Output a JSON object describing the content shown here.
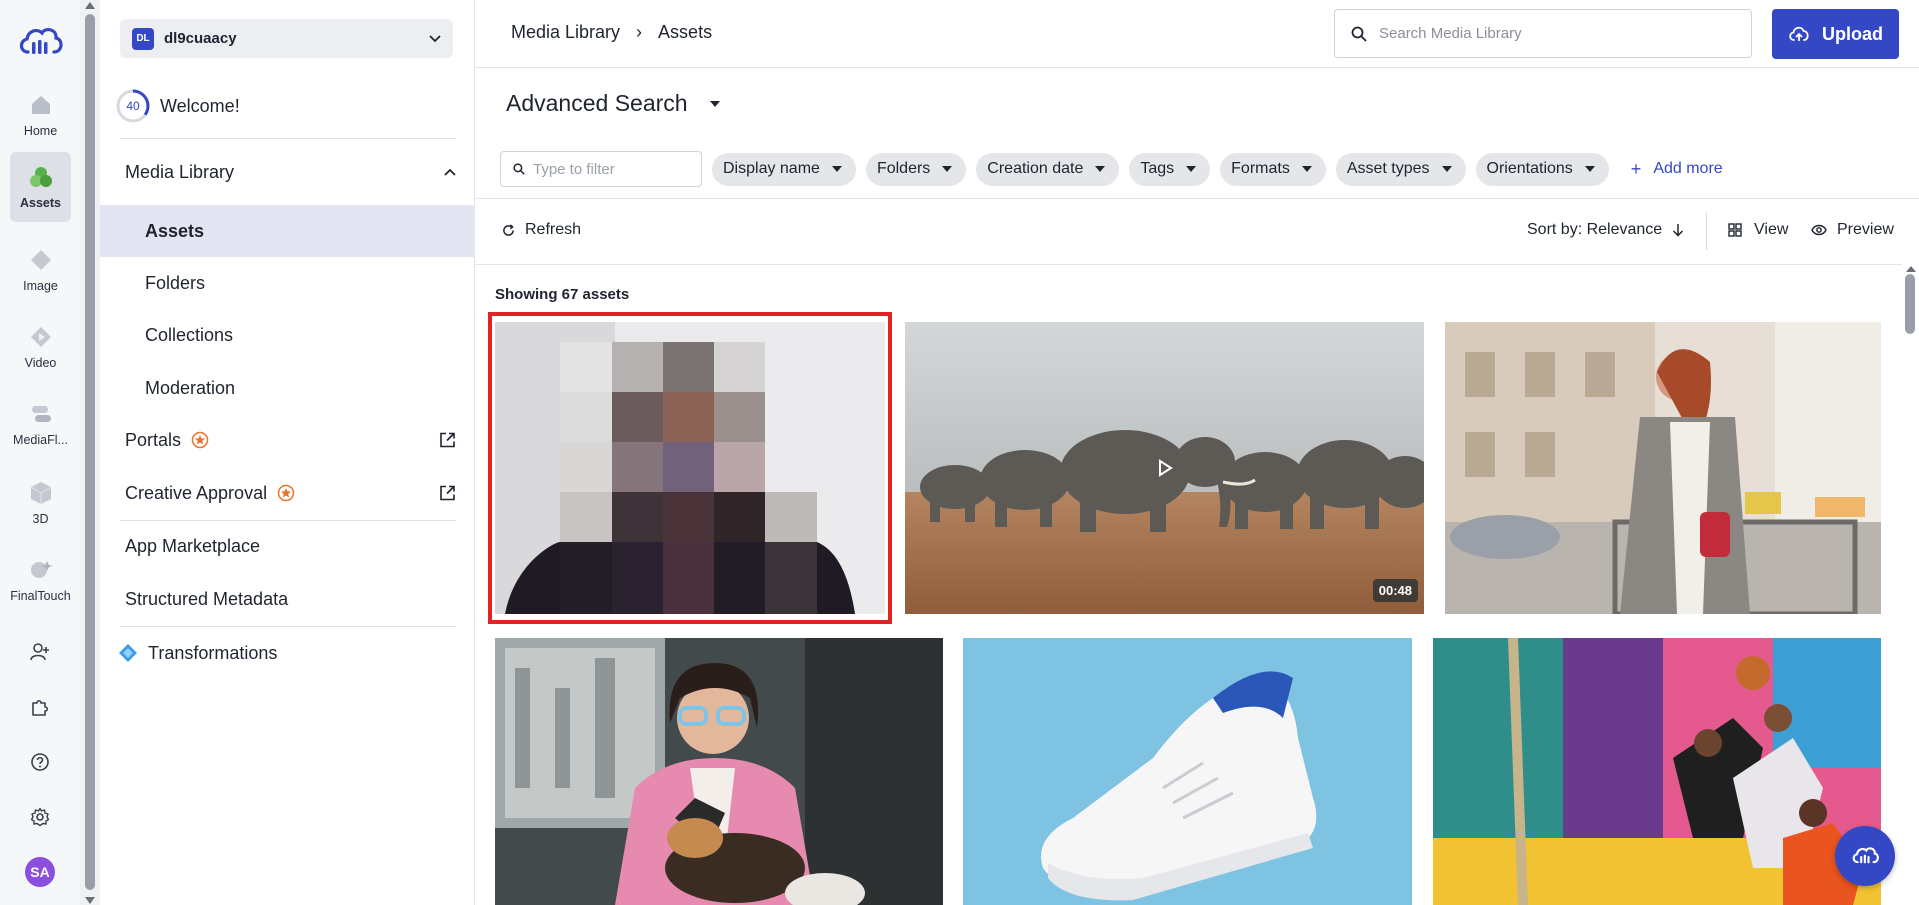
{
  "rail": {
    "items": [
      {
        "label": "Home",
        "icon": "home-icon"
      },
      {
        "label": "Assets",
        "icon": "assets-icon",
        "active": true
      },
      {
        "label": "Image",
        "icon": "image-icon"
      },
      {
        "label": "Video",
        "icon": "video-icon"
      },
      {
        "label": "MediaFl...",
        "icon": "mediaflows-icon"
      },
      {
        "label": "3D",
        "icon": "3d-icon"
      },
      {
        "label": "FinalTouch",
        "icon": "finaltouch-icon"
      }
    ],
    "avatar": "SA"
  },
  "account": {
    "badge": "DL",
    "name": "dl9cuaacy"
  },
  "welcome": {
    "progress": "40",
    "text": "Welcome!"
  },
  "nav": {
    "media_library": "Media Library",
    "assets": "Assets",
    "folders": "Folders",
    "collections": "Collections",
    "moderation": "Moderation",
    "portals": "Portals",
    "creative_approval": "Creative Approval",
    "app_marketplace": "App Marketplace",
    "structured_metadata": "Structured Metadata",
    "transformations": "Transformations"
  },
  "header": {
    "breadcrumb": [
      "Media Library",
      "Assets"
    ],
    "search_placeholder": "Search Media Library",
    "upload_label": "Upload"
  },
  "search": {
    "title": "Advanced Search",
    "filter_placeholder": "Type to filter",
    "chips": [
      "Display name",
      "Folders",
      "Creation date",
      "Tags",
      "Formats",
      "Asset types",
      "Orientations"
    ],
    "add_more": "Add more"
  },
  "toolbar": {
    "refresh": "Refresh",
    "sort": "Sort by: Relevance",
    "view": "View",
    "preview": "Preview"
  },
  "grid": {
    "count_text": "Showing 67 assets",
    "video_duration": "00:48"
  },
  "colors": {
    "brand": "#3448c5",
    "selection": "#e02424",
    "badge_orange": "#e8752f"
  }
}
